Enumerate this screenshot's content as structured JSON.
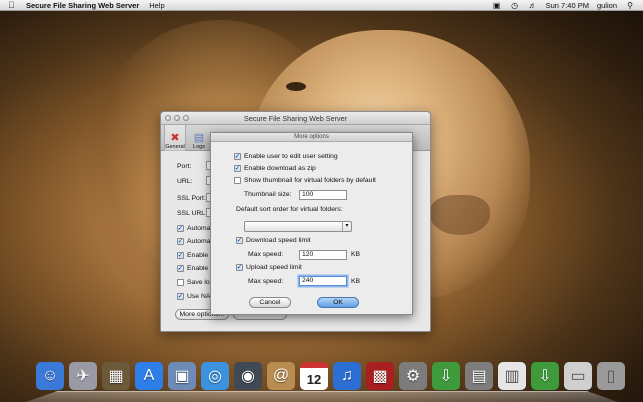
{
  "menubar": {
    "apple": "",
    "app_name": "Secure File Sharing Web Server",
    "menus": [
      "Help"
    ],
    "clock": "Sun 7:40 PM",
    "user": "gulion"
  },
  "window": {
    "title": "Secure File Sharing Web Server",
    "tabs": [
      {
        "label": "General",
        "icon": "tools-icon"
      },
      {
        "label": "Logs",
        "icon": "logs-icon"
      }
    ],
    "labels": {
      "port": "Port:",
      "url": "URL:",
      "ssl_port": "SSL Port:",
      "ssl_url": "SSL URL:"
    },
    "checkboxes": [
      {
        "label": "Automa",
        "checked": true
      },
      {
        "label": "Automa",
        "checked": true
      },
      {
        "label": "Enable",
        "checked": true
      },
      {
        "label": "Enable",
        "checked": true
      },
      {
        "label": "Save log",
        "checked": false
      },
      {
        "label": "Use NAT",
        "checked": true
      }
    ],
    "more_options_label": "More options..."
  },
  "sheet": {
    "title": "More options",
    "enable_user_edit": {
      "label": "Enable user to edit user setting",
      "checked": true
    },
    "enable_download_zip": {
      "label": "Enable download as zip",
      "checked": true
    },
    "show_thumbnail": {
      "label": "Show thumbnail for virtual folders by default",
      "checked": false
    },
    "thumbnail_size": {
      "label": "Thumbnail size:",
      "value": "100"
    },
    "sort_order": {
      "label": "Default sort order for virtual folders:",
      "value": ""
    },
    "download_limit": {
      "label": "Download speed limit",
      "checked": true
    },
    "download_max": {
      "label": "Max speed:",
      "value": "120",
      "unit": "KB"
    },
    "upload_limit": {
      "label": "Upload speed limit",
      "checked": true
    },
    "upload_max": {
      "label": "Max speed:",
      "value": "240",
      "unit": "KB"
    },
    "cancel_label": "Cancel",
    "ok_label": "OK"
  },
  "dock": {
    "items": [
      "finder-icon",
      "launchpad-icon",
      "mission-control-icon",
      "app-store-icon",
      "preview-icon",
      "safari-icon",
      "facetime-icon",
      "contacts-icon",
      "calendar-icon",
      "itunes-icon",
      "photo-booth-icon",
      "system-preferences-icon",
      "file-sharing-app-icon",
      "downloads-stack-icon",
      "documents-stack-icon",
      "file-sharing-app-icon",
      "network-icon",
      "trash-icon"
    ],
    "calendar_day": "12",
    "colors": [
      "#3b79d8",
      "#9a9aa6",
      "#6b5a3a",
      "#2d7ee8",
      "#6d8bb6",
      "#3c92df",
      "#404a55",
      "#b98c52",
      "#ffffff",
      "#2c6fd3",
      "#a81f1f",
      "#7c7c7c",
      "#3e9a3a",
      "#7d7d7d",
      "#e6e6e6",
      "#3e9a3a",
      "#cfcfcf",
      "#9a9a9a"
    ]
  }
}
